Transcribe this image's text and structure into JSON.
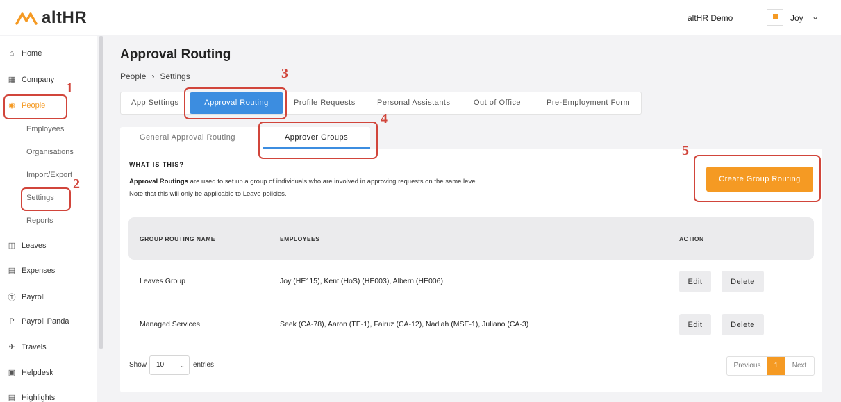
{
  "brand": {
    "logo_text": "altHR",
    "accent": "#f59a23",
    "primary": "#3c8de0",
    "annotation": "#d1453b"
  },
  "header": {
    "company": "altHR Demo",
    "user": "Joy"
  },
  "sidebar": {
    "items": [
      {
        "label": "Home",
        "icon": "home-icon"
      },
      {
        "label": "Company",
        "icon": "building-icon"
      },
      {
        "label": "People",
        "icon": "people-icon",
        "active": true
      },
      {
        "label": "Leaves",
        "icon": "calendar-icon"
      },
      {
        "label": "Expenses",
        "icon": "receipt-icon"
      },
      {
        "label": "Payroll",
        "icon": "dollar-icon"
      },
      {
        "label": "Payroll Panda",
        "icon": "p-icon"
      },
      {
        "label": "Travels",
        "icon": "plane-icon"
      },
      {
        "label": "Helpdesk",
        "icon": "ticket-icon"
      },
      {
        "label": "Highlights",
        "icon": "highlights-icon"
      }
    ],
    "people_sub": [
      "Employees",
      "Organisations",
      "Import/Export",
      "Settings",
      "Reports"
    ]
  },
  "page": {
    "title": "Approval Routing",
    "breadcrumb": [
      "People",
      "Settings"
    ],
    "tabs": [
      "App Settings",
      "Approval Routing",
      "Profile Requests",
      "Personal Assistants",
      "Out of Office",
      "Pre-Employment Form"
    ],
    "subtabs": [
      "General Approval Routing",
      "Approver Groups"
    ],
    "what_title": "WHAT IS THIS?",
    "desc_bold": "Approval Routings",
    "desc_rest": " are used to set up a group of individuals who are involved in approving requests on the same level.",
    "desc2": "Note that this will only be applicable to Leave policies.",
    "create_button": "Create Group Routing"
  },
  "table": {
    "headers": [
      "GROUP ROUTING NAME",
      "EMPLOYEES",
      "ACTION"
    ],
    "rows": [
      {
        "name": "Leaves Group",
        "employees": "Joy (HE115), Kent (HoS) (HE003), Albern (HE006)"
      },
      {
        "name": "Managed Services",
        "employees": "Seek (CA-78), Aaron (TE-1), Fairuz (CA-12), Nadiah (MSE-1), Juliano (CA-3)"
      }
    ],
    "edit_label": "Edit",
    "delete_label": "Delete"
  },
  "footer": {
    "show": "Show",
    "entries_value": "10",
    "entries": "entries",
    "prev": "Previous",
    "page": "1",
    "next": "Next"
  },
  "annotations": [
    "1",
    "2",
    "3",
    "4",
    "5"
  ]
}
